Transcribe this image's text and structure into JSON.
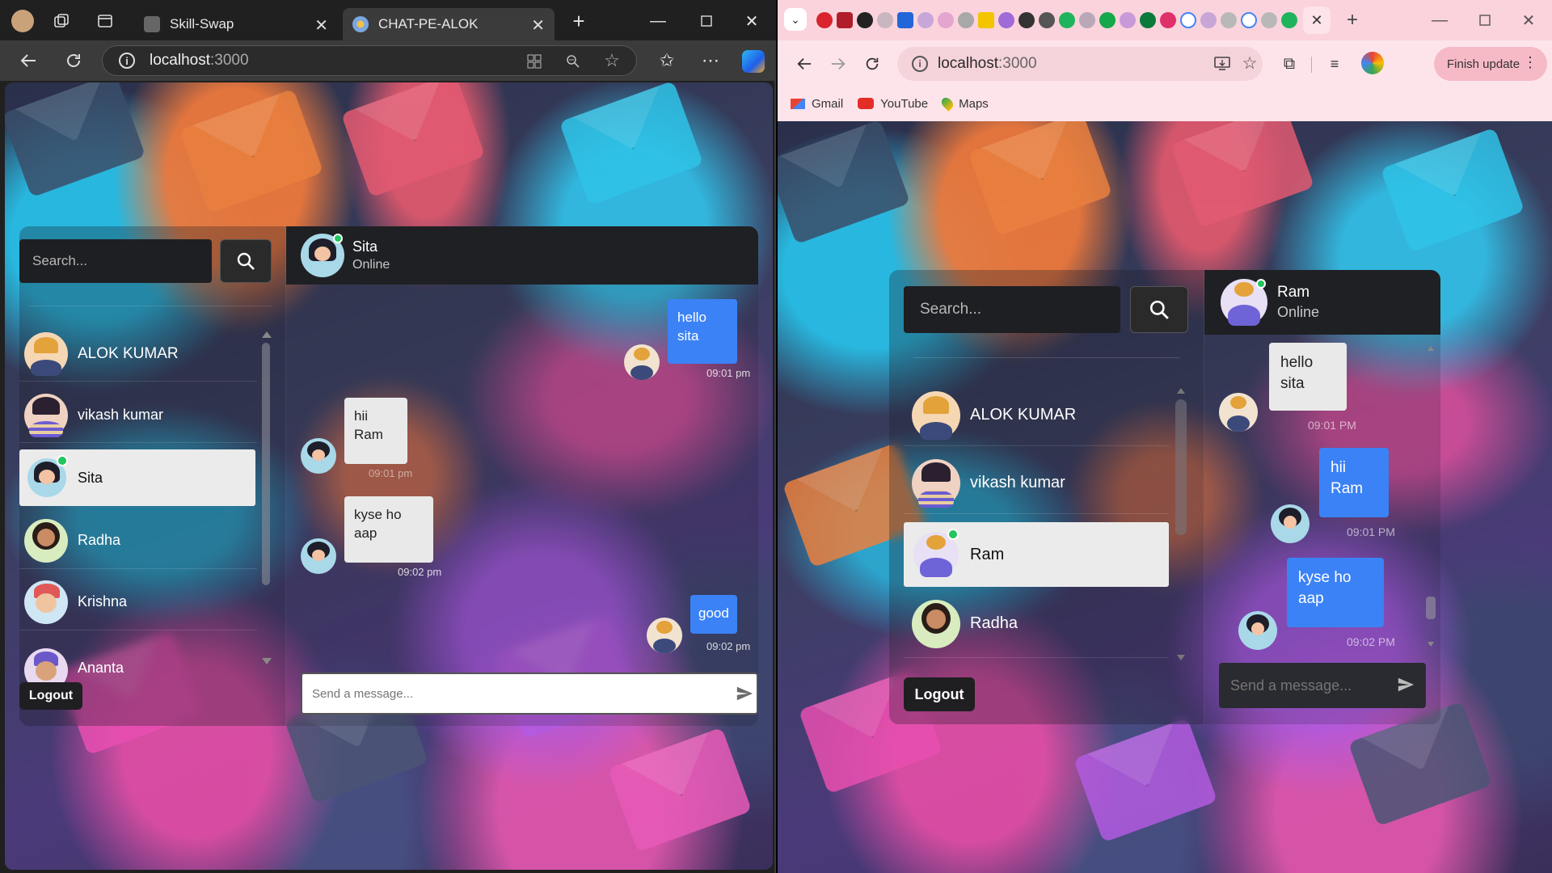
{
  "left_browser": {
    "tabs": [
      {
        "label": "Skill-Swap"
      },
      {
        "label": "CHAT-PE-ALOK"
      }
    ],
    "address": {
      "host": "localhost",
      "port": ":3000"
    }
  },
  "right_browser": {
    "address": {
      "host": "localhost",
      "port": ":3000"
    },
    "finish_update": "Finish update",
    "bookmarks": [
      {
        "label": "Gmail"
      },
      {
        "label": "YouTube"
      },
      {
        "label": "Maps"
      }
    ]
  },
  "left_app": {
    "search_placeholder": "Search...",
    "logout": "Logout",
    "contacts": [
      {
        "name": "ALOK KUMAR"
      },
      {
        "name": "vikash kumar"
      },
      {
        "name": "Sita"
      },
      {
        "name": "Radha"
      },
      {
        "name": "Krishna"
      },
      {
        "name": "Ananta"
      }
    ],
    "chat_header": {
      "name": "Sita",
      "status": "Online"
    },
    "messages": [
      {
        "text": "hello sita",
        "time": "09:01 pm"
      },
      {
        "text": "hii Ram",
        "time": "09:01 pm"
      },
      {
        "text": "kyse ho aap",
        "time": "09:02 pm"
      },
      {
        "text": "good",
        "time": "09:02 pm"
      }
    ],
    "message_placeholder": "Send a message..."
  },
  "right_app": {
    "search_placeholder": "Search...",
    "logout": "Logout",
    "contacts": [
      {
        "name": "ALOK KUMAR"
      },
      {
        "name": "vikash kumar"
      },
      {
        "name": "Ram"
      },
      {
        "name": "Radha"
      }
    ],
    "chat_header": {
      "name": "Ram",
      "status": "Online"
    },
    "messages": [
      {
        "text": "hello sita",
        "time": "09:01 PM"
      },
      {
        "text": "hii Ram",
        "time": "09:01 PM"
      },
      {
        "text": "kyse ho aap",
        "time": "09:02 PM"
      }
    ],
    "message_placeholder": "Send a message..."
  },
  "colors": {
    "accent_blue": "#3b82f6",
    "online_green": "#22c55e",
    "edge_chrome": "#202020",
    "chrome_pink": "#fde4ea"
  }
}
